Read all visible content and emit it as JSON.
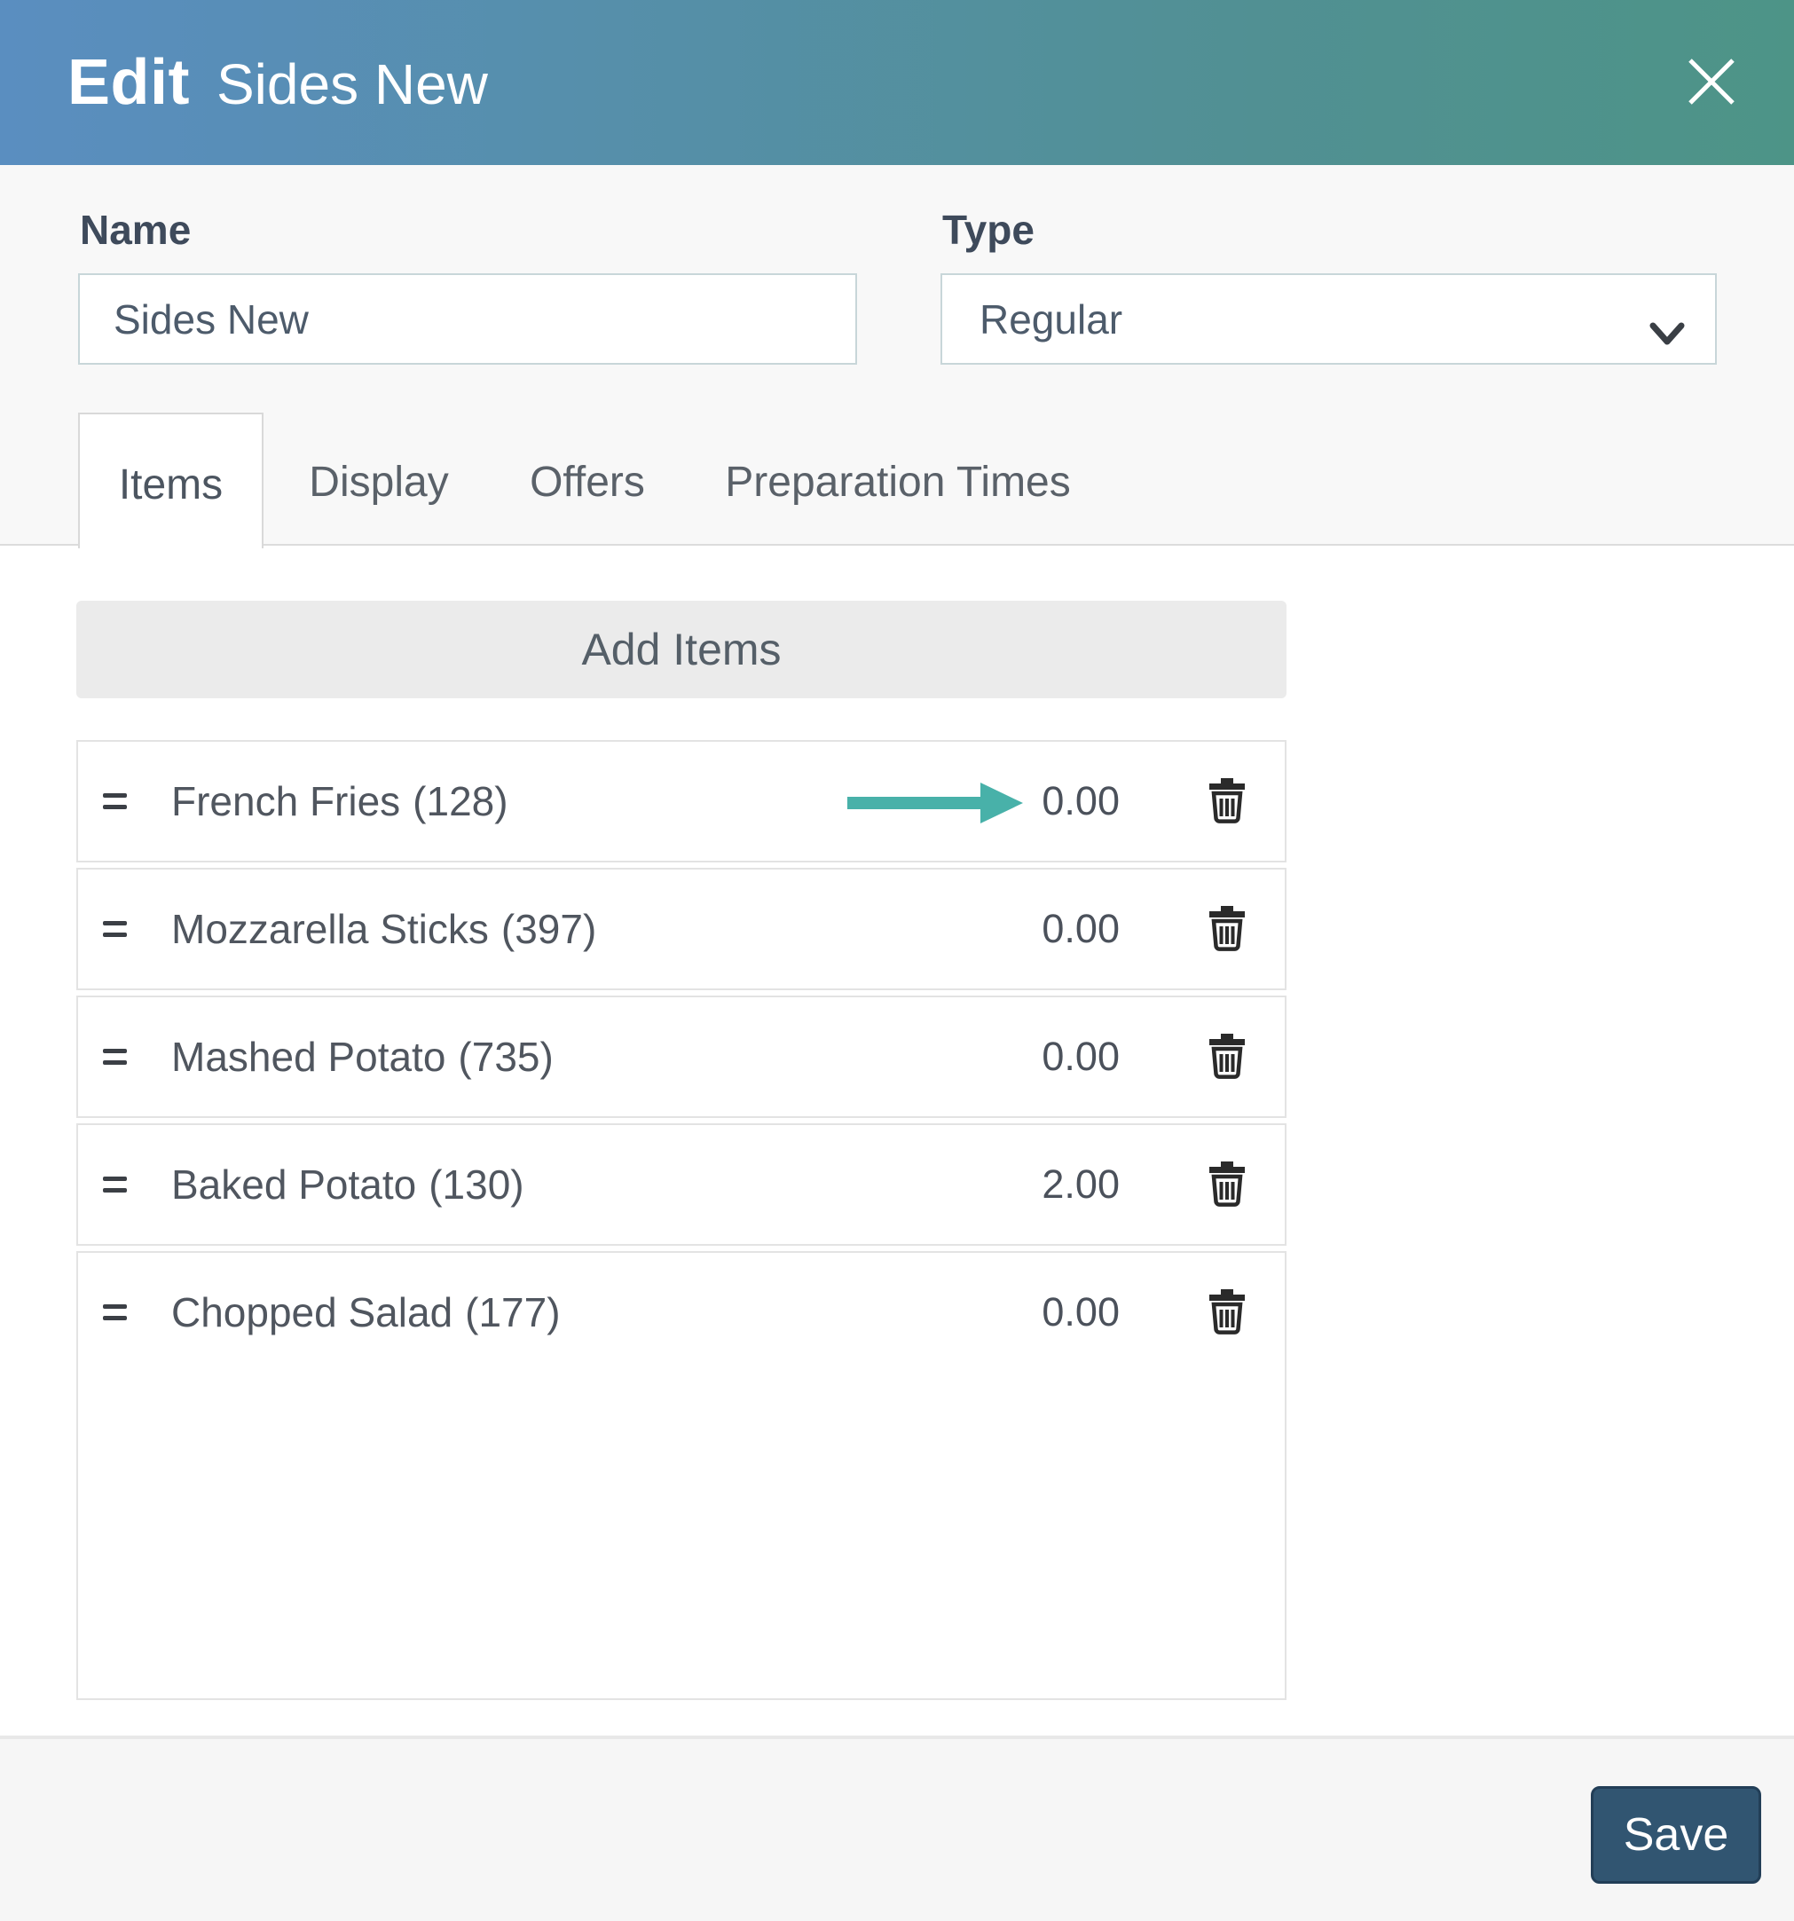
{
  "modal": {
    "title_action": "Edit",
    "title_subject": "Sides New"
  },
  "form": {
    "name": {
      "label": "Name",
      "value": "Sides New"
    },
    "type": {
      "label": "Type",
      "value": "Regular"
    }
  },
  "tabs": [
    {
      "label": "Items",
      "active": true
    },
    {
      "label": "Display",
      "active": false
    },
    {
      "label": "Offers",
      "active": false
    },
    {
      "label": "Preparation Times",
      "active": false
    }
  ],
  "items_panel": {
    "add_button_label": "Add Items"
  },
  "items": [
    {
      "name": "French Fries",
      "count": "(128)",
      "price": "0.00"
    },
    {
      "name": "Mozzarella Sticks",
      "count": "(397)",
      "price": "0.00"
    },
    {
      "name": "Mashed Potato",
      "count": "(735)",
      "price": "0.00"
    },
    {
      "name": "Baked Potato",
      "count": "(130)",
      "price": "2.00"
    },
    {
      "name": "Chopped Salad",
      "count": "(177)",
      "price": "0.00"
    }
  ],
  "footer": {
    "save_label": "Save"
  },
  "icons": {
    "close": "close-icon",
    "chevron": "chevron-down-icon",
    "drag": "drag-handle-icon",
    "trash": "trash-icon",
    "annotation": "arrow-right-icon"
  },
  "colors": {
    "header_gradient_start": "#5a8ec0",
    "header_gradient_end": "#4d9487",
    "annotation_arrow": "#48b1a9",
    "save_button": "#315571",
    "save_button_border": "#223e57",
    "top_section_bg": "#f8f8f8",
    "footer_bg": "#f6f6f6",
    "add_items_bg": "#ebebeb",
    "row_border": "#e3e3e3"
  }
}
